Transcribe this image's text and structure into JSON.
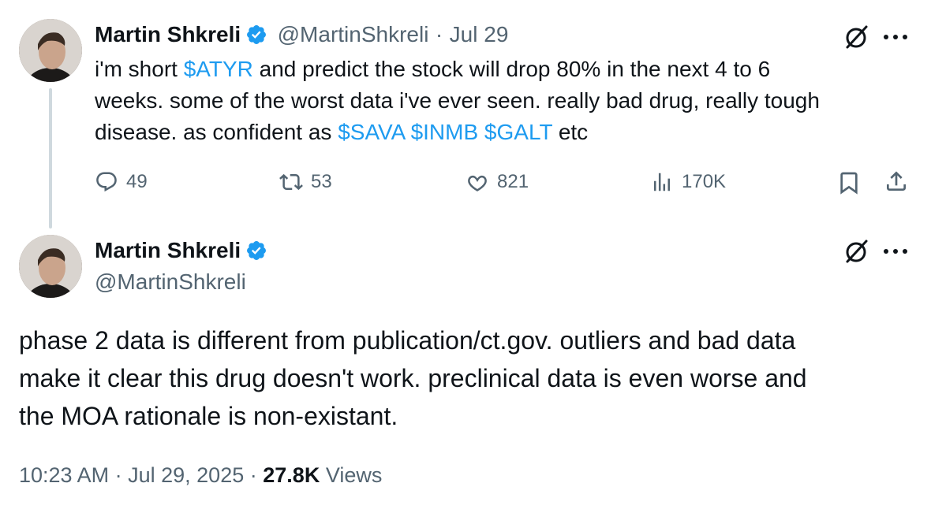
{
  "parent_tweet": {
    "author_name": "Martin Shkreli",
    "author_handle": "@MartinShkreli",
    "separator": "·",
    "date": "Jul 29",
    "text_1": "i'm short ",
    "cashtag_1": "$ATYR",
    "text_2": " and predict the stock will drop 80% in the next 4 to 6",
    "text_3": "weeks. some of the worst data i've ever seen. really bad drug, really tough",
    "text_4": "disease. as confident as ",
    "cashtag_2": "$SAVA",
    "cashtag_3": "$INMB",
    "cashtag_4": "$GALT",
    "text_5": " etc",
    "replies": "49",
    "reposts": "53",
    "likes": "821",
    "views": "170K",
    "icons": [
      "reply-icon",
      "repost-icon",
      "like-icon",
      "views-icon",
      "bookmark-icon",
      "share-icon",
      "grok-icon",
      "more-icon",
      "verified-icon"
    ]
  },
  "main_tweet": {
    "author_name": "Martin Shkreli",
    "author_handle": "@MartinShkreli",
    "line_1": "phase 2 data is different from publication/ct.gov. outliers and bad data",
    "line_2": "make it clear this drug doesn't work. preclinical data is even worse and",
    "line_3": "the MOA rationale is non-existant.",
    "time": "10:23 AM",
    "sep_1": "·",
    "date": "Jul 29, 2025",
    "sep_2": "·",
    "view_count": "27.8K",
    "views_label": "Views"
  },
  "colors": {
    "link": "#1d9bf0",
    "secondary_text": "#536471",
    "primary_text": "#0f1419",
    "verified_badge": "#1d9bf0"
  }
}
